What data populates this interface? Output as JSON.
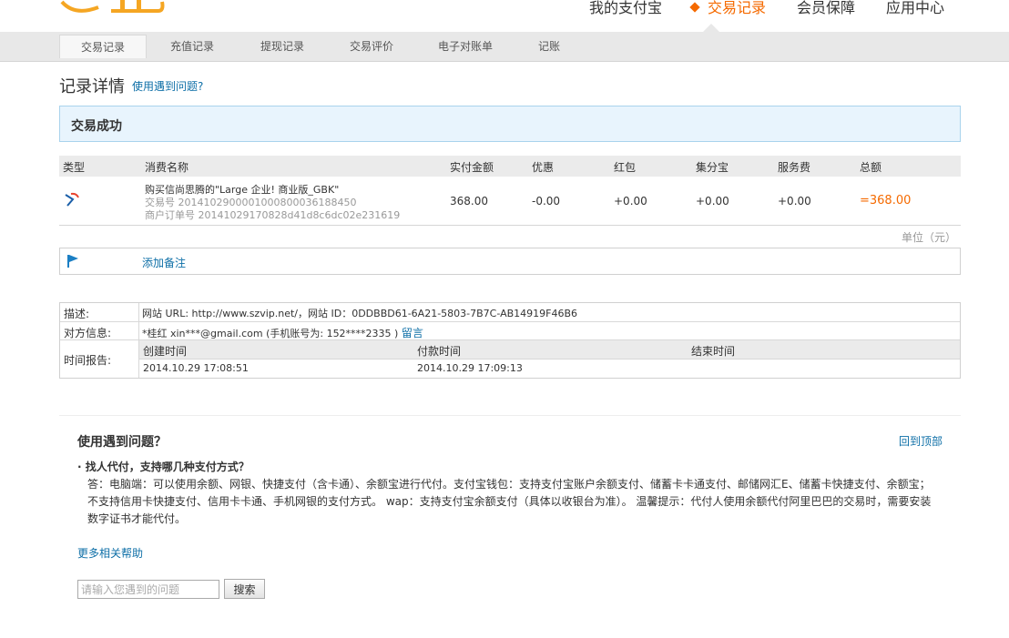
{
  "header": {
    "nav": [
      {
        "label": "我的支付宝",
        "active": false
      },
      {
        "label": "交易记录",
        "active": true
      },
      {
        "label": "会员保障",
        "active": false
      },
      {
        "label": "应用中心",
        "active": false
      }
    ],
    "accent_color": "#f56a00"
  },
  "subnav": {
    "tabs": [
      {
        "label": "交易记录",
        "active": true
      },
      {
        "label": "充值记录",
        "active": false
      },
      {
        "label": "提现记录",
        "active": false
      },
      {
        "label": "交易评价",
        "active": false
      },
      {
        "label": "电子对账单",
        "active": false
      },
      {
        "label": "记账",
        "active": false
      }
    ]
  },
  "page": {
    "title": "记录详情",
    "help_link": "使用遇到问题?",
    "status": "交易成功"
  },
  "transaction": {
    "headers": [
      "类型",
      "消费名称",
      "实付金额",
      "优惠",
      "红包",
      "集分宝",
      "服务费",
      "总额"
    ],
    "type_icon": "shopping-icon",
    "name": "购买信尚思腾的\"Large 企业! 商业版_GBK\"",
    "trade_no": "交易号 2014102900001000800036188450",
    "order_no": "商户订单号 20141029170828d41d8c6dc02e231619",
    "paid": "368.00",
    "discount": "-0.00",
    "red_packet": "+0.00",
    "points": "+0.00",
    "service_fee": "+0.00",
    "total": "=368.00",
    "unit": "单位（元）"
  },
  "note": {
    "icon": "flag-icon",
    "add_label": "添加备注"
  },
  "info": {
    "desc_label": "描述:",
    "desc_value": "网站 URL: http://www.szvip.net/，网站 ID：0DDBBD61-6A21-5803-7B7C-AB14919F46B6",
    "party_label": "对方信息:",
    "party_value": "*桂红 xin***@gmail.com (手机账号为: 152****2335 )",
    "party_link": "留言",
    "time_label": "时间报告:",
    "created_label": "创建时间",
    "paid_label": "付款时间",
    "finished_label": "结束时间",
    "created_value": "2014.10.29 17:08:51",
    "paid_value": "2014.10.29 17:09:13",
    "finished_value": ""
  },
  "help": {
    "title": "使用遇到问题？",
    "back_top": "回到顶部",
    "question": "· 找人代付，支持哪几种支付方式？",
    "answer_1": "答：电脑端：可以使用余额、网银、快捷支付（含卡通）、余额宝进行代付。支付宝钱包：支持支付宝账户余额支付、储蓄卡卡通支付、邮储网汇E、储蓄卡快捷支付、余额宝；",
    "answer_2": "不支持信用卡快捷支付、信用卡卡通、手机网银的支付方式。 wap：支持支付宝余额支付（具体以收银台为准）。 温馨提示：代付人使用余额代付阿里巴巴的交易时，需要安装",
    "answer_3": "数字证书才能代付。",
    "more_help": "更多相关帮助",
    "search_placeholder": "请输入您遇到的问题",
    "search_button": "搜索"
  }
}
